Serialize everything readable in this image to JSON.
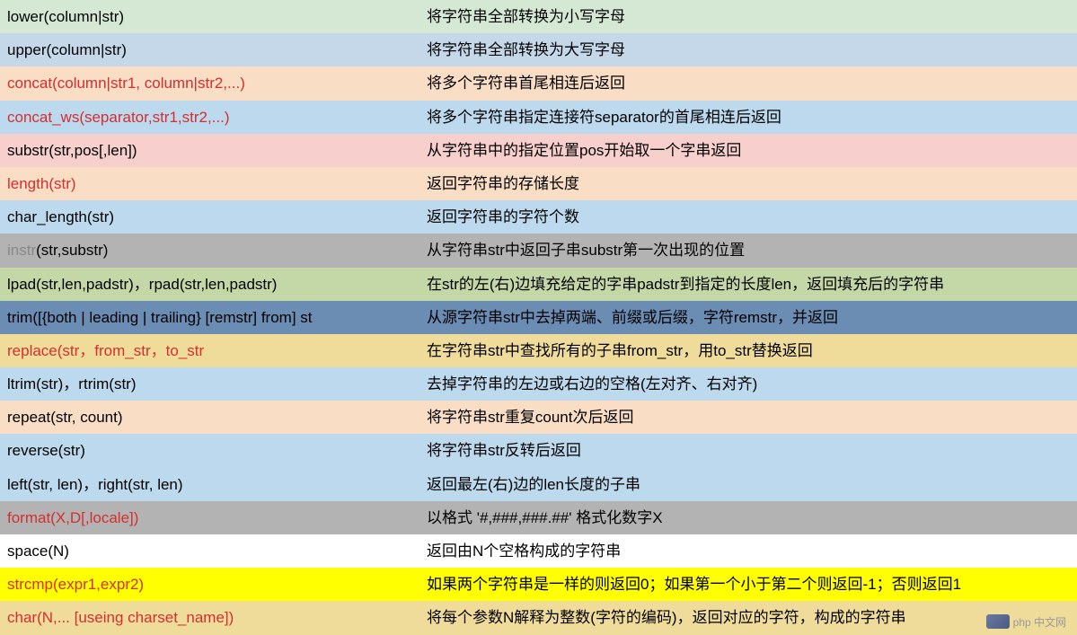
{
  "rows": [
    {
      "func": "lower(column|str)",
      "desc": "将字符串全部转换为小写字母",
      "bgClass": "bg-green-light",
      "red": false
    },
    {
      "func": "upper(column|str)",
      "desc": "将字符串全部转换为大写字母",
      "bgClass": "bg-blue-light",
      "red": false
    },
    {
      "func": "concat(column|str1, column|str2,...)",
      "desc": "将多个字符串首尾相连后返回",
      "bgClass": "bg-orange-light",
      "red": true
    },
    {
      "func": "concat_ws(separator,str1,str2,...)",
      "desc": "将多个字符串指定连接符separator的首尾相连后返回",
      "bgClass": "bg-blue-sky",
      "red": true
    },
    {
      "func": "substr(str,pos[,len])",
      "desc": "从字符串中的指定位置pos开始取一个字串返回",
      "bgClass": "bg-red-light",
      "red": false
    },
    {
      "func": "length(str)",
      "desc": "返回字符串的存储长度",
      "bgClass": "bg-orange-light",
      "red": true
    },
    {
      "func": "char_length(str)",
      "desc": "返回字符串的字符个数",
      "bgClass": "bg-blue-sky",
      "red": false
    },
    {
      "func": "instr(str,substr)",
      "prefix": "instr",
      "suffix": "(str,substr)",
      "desc": "从字符串str中返回子串substr第一次出现的位置",
      "bgClass": "bg-gray",
      "red": false,
      "prefixGray": true
    },
    {
      "func": "lpad(str,len,padstr)，rpad(str,len,padstr)",
      "desc": "在str的左(右)边填充给定的字串padstr到指定的长度len，返回填充后的字符串",
      "bgClass": "bg-green-med",
      "red": false
    },
    {
      "func": "trim([{both | leading | trailing} [remstr] from] st",
      "desc": "从源字符串str中去掉两端、前缀或后缀，字符remstr，并返回",
      "bgClass": "bg-blue-dark",
      "red": false
    },
    {
      "func": "replace(str，from_str，to_str",
      "desc": "在字符串str中查找所有的子串from_str，用to_str替换返回",
      "bgClass": "bg-tan",
      "red": true
    },
    {
      "func": "ltrim(str)，rtrim(str)",
      "desc": "去掉字符串的左边或右边的空格(左对齐、右对齐)",
      "bgClass": "bg-blue-sky",
      "red": false
    },
    {
      "func": "repeat(str, count)",
      "desc": "将字符串str重复count次后返回",
      "bgClass": "bg-orange-light",
      "red": false
    },
    {
      "func": "reverse(str)",
      "desc": "将字符串str反转后返回",
      "bgClass": "bg-blue-sky",
      "red": false
    },
    {
      "func": "left(str, len)，right(str, len)",
      "desc": "返回最左(右)边的len长度的子串",
      "bgClass": "bg-blue-sky",
      "red": false
    },
    {
      "func": "format(X,D[,locale])",
      "desc": "以格式 '#,###,###.##' 格式化数字X",
      "bgClass": "bg-gray",
      "red": true
    },
    {
      "func": "space(N)",
      "desc": "返回由N个空格构成的字符串",
      "bgClass": "",
      "red": false
    },
    {
      "func": "strcmp(expr1,expr2)",
      "desc": "如果两个字符串是一样的则返回0；如果第一个小于第二个则返回-1；否则返回1",
      "bgClass": "bg-yellow",
      "red": true
    },
    {
      "func": "char(N,... [useing  charset_name])",
      "desc": "将每个参数N解释为整数(字符的编码)，返回对应的字符，构成的字符串",
      "bgClass": "bg-tan",
      "red": true
    }
  ],
  "watermark": "php 中文网"
}
